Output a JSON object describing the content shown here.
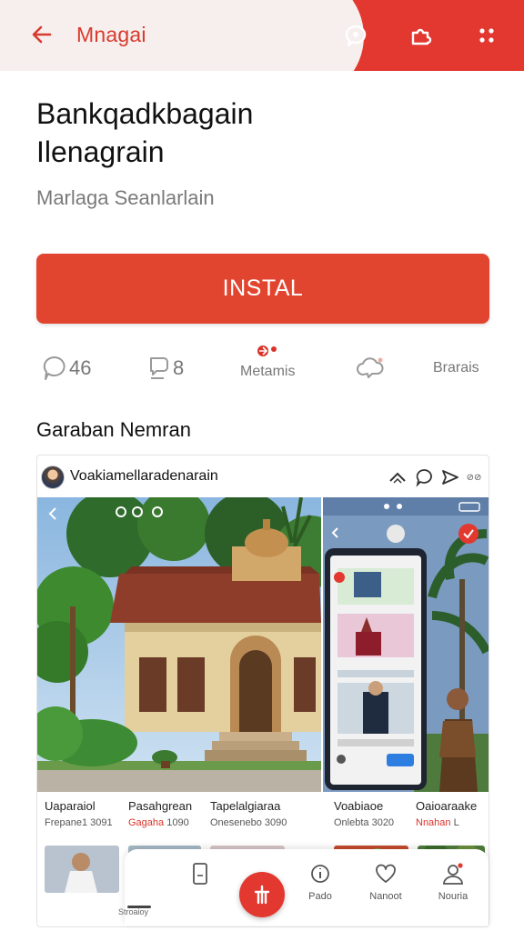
{
  "header": {
    "title": "Mnagai",
    "colors": {
      "bar": "#e2382f",
      "pill": "#f6efee",
      "accent": "#d93a2e"
    },
    "icons": [
      "back-arrow-icon",
      "chat-bubble-icon",
      "puzzle-icon",
      "more-dots-icon"
    ]
  },
  "app": {
    "name_line1": "Bankqadkbagain",
    "name_line2": "Ilenagrain",
    "publisher": "Marlaga Seanlarlain",
    "install_label": "INSTAL"
  },
  "stats": {
    "rating_value": "46",
    "reviews_value": "8",
    "category_label": "Metamis",
    "badge_label": "Brarais"
  },
  "section": {
    "title": "Garaban Nemran"
  },
  "card": {
    "title": "Voakiamellaradenarain",
    "status_text": "⊘⊘"
  },
  "grid": {
    "items": [
      {
        "title": "Uaparaiol",
        "sub": "Frepane1 3091"
      },
      {
        "title": "Pasahgrean",
        "sub_red": "Gagaha",
        "sub": "1090"
      },
      {
        "title": "Tapelalgiaraa",
        "sub": "Onesenebo 3090"
      },
      {
        "title": "Voabiaoe",
        "sub": "Onlebta 3020"
      },
      {
        "title": "Oaioaraake",
        "sub_red": "Nnahan",
        "sub": "L"
      }
    ]
  },
  "bottom_nav": {
    "caption": "Stroaioy",
    "items": [
      {
        "label": "",
        "icon": "phone-icon"
      },
      {
        "label": "Pado",
        "icon": "info-icon"
      },
      {
        "label": "Nanoot",
        "icon": "heart-icon"
      },
      {
        "label": "Nouria",
        "icon": "profile-icon"
      }
    ],
    "fab_icon": "add-icon"
  }
}
